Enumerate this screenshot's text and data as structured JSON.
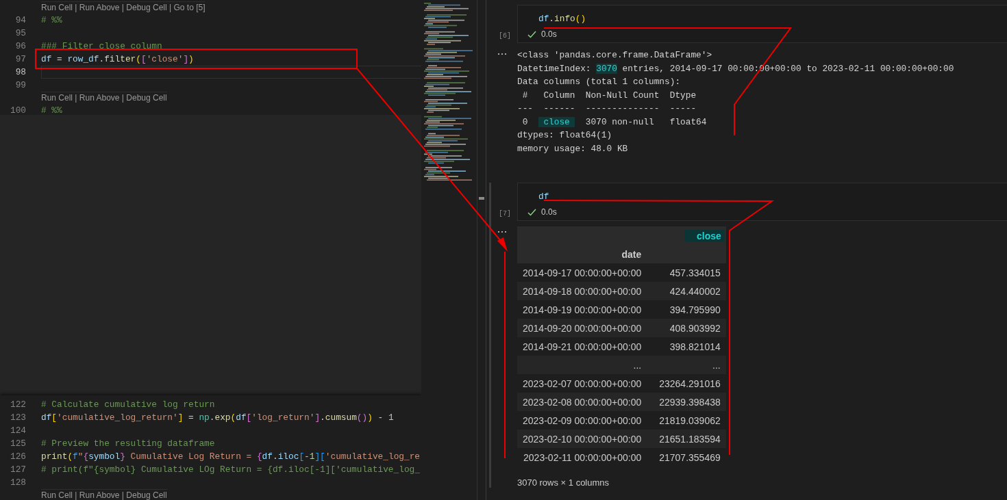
{
  "editor": {
    "top_lines": [
      {
        "kind": "codelens",
        "text": "Run Cell | Run Above | Debug Cell | Go to [5]"
      },
      {
        "kind": "code",
        "number": "94",
        "current": false,
        "tokens": [
          {
            "text": "# %%",
            "kind": "comment"
          }
        ]
      },
      {
        "kind": "code",
        "number": "95",
        "current": false
      },
      {
        "kind": "code",
        "number": "96",
        "current": false,
        "tokens": [
          {
            "text": "### Filter close column",
            "kind": "comment"
          }
        ]
      },
      {
        "kind": "code",
        "number": "97",
        "current": false,
        "tokens": [
          {
            "text": "df",
            "kind": "var"
          },
          {
            "text": " = ",
            "kind": "plain"
          },
          {
            "text": "row_df",
            "kind": "var"
          },
          {
            "text": ".",
            "kind": "plain"
          },
          {
            "text": "filter",
            "kind": "func"
          },
          {
            "text": "(",
            "kind": "bracket1"
          },
          {
            "text": "[",
            "kind": "bracket2"
          },
          {
            "text": "'close'",
            "kind": "string"
          },
          {
            "text": "]",
            "kind": "bracket2"
          },
          {
            "text": ")",
            "kind": "bracket1"
          }
        ]
      },
      {
        "kind": "code",
        "number": "98",
        "current": true
      },
      {
        "kind": "code",
        "number": "99",
        "current": false
      },
      {
        "kind": "codelens",
        "text": "Run Cell | Run Above | Debug Cell"
      },
      {
        "kind": "code",
        "number": "100",
        "current": false,
        "tokens": [
          {
            "text": "# %%",
            "kind": "comment"
          }
        ]
      }
    ],
    "bottom_lines": [
      {
        "kind": "code",
        "number": "122",
        "current": false,
        "tokens": [
          {
            "text": "# Calculate cumulative log return",
            "kind": "comment"
          }
        ]
      },
      {
        "kind": "code",
        "number": "123",
        "current": false,
        "tokens": [
          {
            "text": "df",
            "kind": "var"
          },
          {
            "text": "[",
            "kind": "bracket1"
          },
          {
            "text": "'cumulative_log_return'",
            "kind": "string"
          },
          {
            "text": "]",
            "kind": "bracket1"
          },
          {
            "text": " = ",
            "kind": "plain"
          },
          {
            "text": "np",
            "kind": "module"
          },
          {
            "text": ".",
            "kind": "plain"
          },
          {
            "text": "exp",
            "kind": "func"
          },
          {
            "text": "(",
            "kind": "bracket1"
          },
          {
            "text": "df",
            "kind": "var"
          },
          {
            "text": "[",
            "kind": "bracket2"
          },
          {
            "text": "'log_return'",
            "kind": "string"
          },
          {
            "text": "]",
            "kind": "bracket2"
          },
          {
            "text": ".",
            "kind": "plain"
          },
          {
            "text": "cumsum",
            "kind": "func"
          },
          {
            "text": "()",
            "kind": "bracket2"
          },
          {
            "text": ")",
            "kind": "bracket1"
          },
          {
            "text": " - ",
            "kind": "plain"
          },
          {
            "text": "1",
            "kind": "number"
          }
        ]
      },
      {
        "kind": "code",
        "number": "124",
        "current": false
      },
      {
        "kind": "code",
        "number": "125",
        "current": false,
        "tokens": [
          {
            "text": "# Preview the resulting dataframe",
            "kind": "comment"
          }
        ]
      },
      {
        "kind": "code",
        "number": "126",
        "current": false,
        "tokens": [
          {
            "text": "print",
            "kind": "func"
          },
          {
            "text": "(",
            "kind": "bracket1"
          },
          {
            "text": "f",
            "kind": "keyword"
          },
          {
            "text": "\"",
            "kind": "string"
          },
          {
            "text": "{",
            "kind": "bracket2"
          },
          {
            "text": "symbol",
            "kind": "var"
          },
          {
            "text": "}",
            "kind": "bracket2"
          },
          {
            "text": " Cumulative Log Return = ",
            "kind": "string"
          },
          {
            "text": "{",
            "kind": "bracket2"
          },
          {
            "text": "df",
            "kind": "var"
          },
          {
            "text": ".",
            "kind": "plain"
          },
          {
            "text": "iloc",
            "kind": "var"
          },
          {
            "text": "[",
            "kind": "bracket3"
          },
          {
            "text": "-1",
            "kind": "number"
          },
          {
            "text": "]",
            "kind": "bracket3"
          },
          {
            "text": "[",
            "kind": "bracket3"
          },
          {
            "text": "'cumulative_log_re",
            "kind": "string"
          }
        ]
      },
      {
        "kind": "code",
        "number": "127",
        "current": false,
        "tokens": [
          {
            "text": "# print(f\"{symbol} Cumulative LOg Return = {df.iloc[-1]['cumulative_log_",
            "kind": "comment"
          }
        ]
      },
      {
        "kind": "code",
        "number": "128",
        "current": false
      },
      {
        "kind": "codelens",
        "text": "Run Cell | Run Above | Debug Cell"
      }
    ]
  },
  "notebook": {
    "cells": [
      {
        "execution_count": "[6]",
        "focused": false,
        "succeeded": true,
        "duration": "0.0s",
        "code_tokens": [
          {
            "text": "df",
            "kind": "var"
          },
          {
            "text": ".",
            "kind": "plain"
          },
          {
            "text": "info",
            "kind": "func"
          },
          {
            "text": "()",
            "kind": "bracket1"
          }
        ],
        "output": {
          "kind": "text",
          "lines": [
            [
              {
                "text": "<class 'pandas.core.frame.DataFrame'>",
                "kind": "plain"
              }
            ],
            [
              {
                "text": "DatetimeIndex: ",
                "kind": "plain"
              },
              {
                "text": "3070",
                "kind": "highlight"
              },
              {
                "text": " entries, 2014-09-17 00:00:00+00:00 to 2023-02-11 00:00:00+00:00",
                "kind": "plain"
              }
            ],
            [
              {
                "text": "Data columns (total 1 columns):",
                "kind": "plain"
              }
            ],
            [
              {
                "text": " #   Column  Non-Null Count  Dtype",
                "kind": "plain"
              }
            ],
            [
              {
                "text": "---  ------  --------------  -----",
                "kind": "plain"
              }
            ],
            [
              {
                "text": " 0  ",
                "kind": "plain"
              },
              {
                "text": " close ",
                "kind": "highlight"
              },
              {
                "text": "  3070 non-null   float64",
                "kind": "plain"
              }
            ],
            [
              {
                "text": "dtypes: float64(1)",
                "kind": "plain"
              }
            ],
            [
              {
                "text": "memory usage: 48.0 KB",
                "kind": "plain"
              }
            ]
          ]
        }
      },
      {
        "execution_count": "[7]",
        "focused": true,
        "succeeded": true,
        "duration": "0.0s",
        "code_tokens": [
          {
            "text": "df",
            "kind": "var"
          }
        ],
        "output": {
          "kind": "table",
          "column": "close",
          "index_name": "date",
          "rows": [
            {
              "index": "2014-09-17 00:00:00+00:00",
              "value": "457.334015"
            },
            {
              "index": "2014-09-18 00:00:00+00:00",
              "value": "424.440002"
            },
            {
              "index": "2014-09-19 00:00:00+00:00",
              "value": "394.795990"
            },
            {
              "index": "2014-09-20 00:00:00+00:00",
              "value": "408.903992"
            },
            {
              "index": "2014-09-21 00:00:00+00:00",
              "value": "398.821014"
            },
            {
              "index": "...",
              "value": "..."
            },
            {
              "index": "2023-02-07 00:00:00+00:00",
              "value": "23264.291016"
            },
            {
              "index": "2023-02-08 00:00:00+00:00",
              "value": "22939.398438"
            },
            {
              "index": "2023-02-09 00:00:00+00:00",
              "value": "21819.039062"
            },
            {
              "index": "2023-02-10 00:00:00+00:00",
              "value": "21651.183594"
            },
            {
              "index": "2023-02-11 00:00:00+00:00",
              "value": "21707.355469"
            }
          ],
          "summary": "3070 rows × 1 columns"
        }
      }
    ]
  },
  "annotations": [
    {
      "kind": "box"
    },
    {
      "kind": "arrow"
    },
    {
      "kind": "bracket"
    },
    {
      "kind": "bracket"
    }
  ]
}
